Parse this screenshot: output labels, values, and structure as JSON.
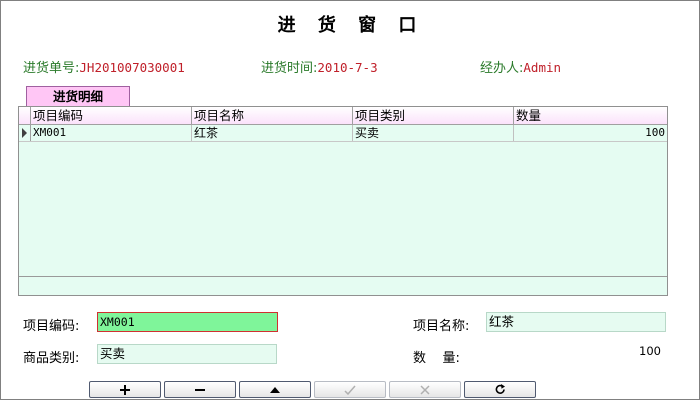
{
  "window": {
    "title": "进 货 窗 口"
  },
  "header": {
    "order_label": "进货单号:",
    "order_value": "JH201007030001",
    "time_label": "进货时间:",
    "time_value": "2010-7-3",
    "operator_label": "经办人:",
    "operator_value": "Admin"
  },
  "tab": {
    "label": "进货明细"
  },
  "grid": {
    "columns": [
      "项目编码",
      "项目名称",
      "项目类别",
      "数量"
    ],
    "rows": [
      {
        "code": "XM001",
        "name": "红茶",
        "category": "买卖",
        "qty": "100"
      }
    ]
  },
  "form": {
    "code_label": "项目编码:",
    "code_value": "XM001",
    "name_label": "项目名称:",
    "name_value": "红茶",
    "category_label": "商品类别:",
    "category_value": "买卖",
    "qty_label": "数    量:",
    "qty_value": "100"
  },
  "toolbar": {
    "buttons": [
      {
        "icon": "plus-icon",
        "enabled": true
      },
      {
        "icon": "minus-icon",
        "enabled": true
      },
      {
        "icon": "triangle-up-icon",
        "enabled": true
      },
      {
        "icon": "checkmark-icon",
        "enabled": false
      },
      {
        "icon": "x-icon",
        "enabled": false
      },
      {
        "icon": "refresh-icon",
        "enabled": true
      }
    ]
  },
  "colors": {
    "label_green": "#2a7a2a",
    "value_red": "#c0202a",
    "tab_pink": "#ffc6f5",
    "grid_bg": "#e5fcf2",
    "active_field": "#7ff59a"
  }
}
